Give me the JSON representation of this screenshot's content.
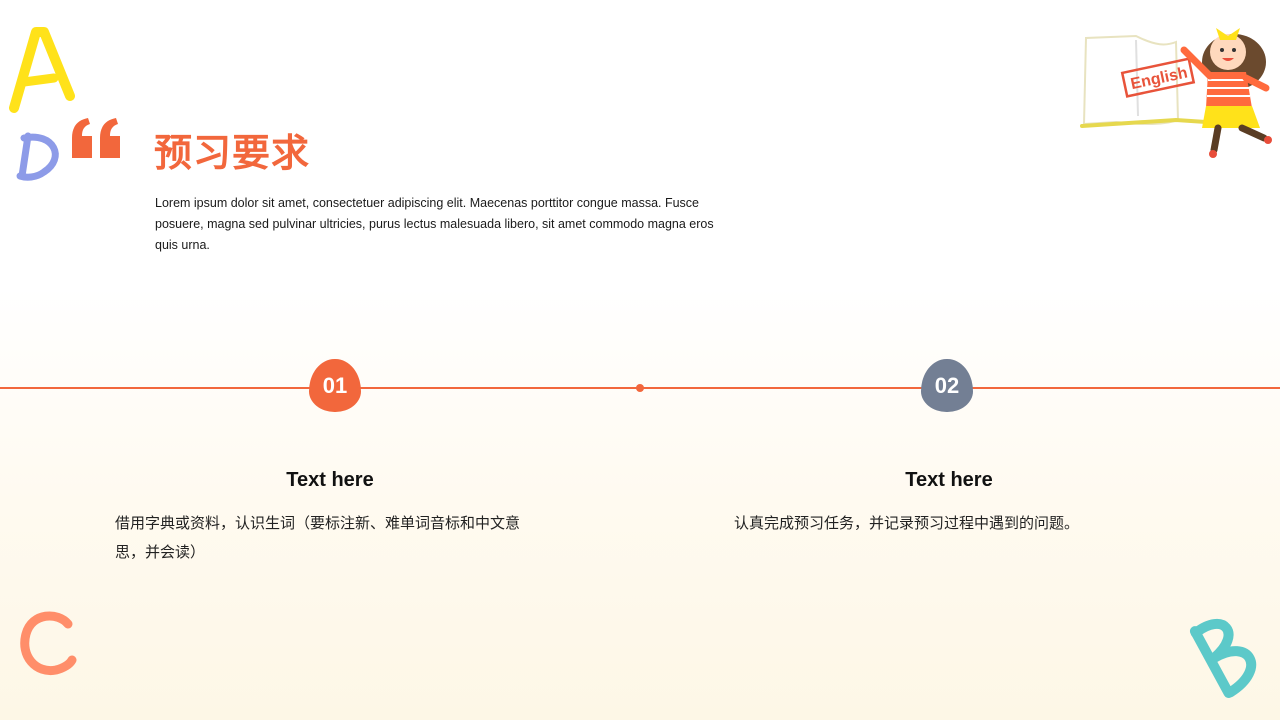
{
  "header": {
    "title": "预习要求",
    "description": "Lorem ipsum dolor sit amet, consectetuer adipiscing elit. Maecenas porttitor congue massa. Fusce posuere, magna sed pulvinar ultricies, purus lectus malesuada libero, sit amet commodo magna eros quis urna."
  },
  "decorations": {
    "letters": [
      "A",
      "D",
      "C",
      "B"
    ],
    "illustration_label": "English",
    "icons": [
      "quote-icon",
      "girl-with-book-illustration"
    ]
  },
  "timeline": {
    "items": [
      {
        "number": "01",
        "title": "Text here",
        "text": "借用字典或资料，认识生词（要标注新、难单词音标和中文意思，并会读）",
        "badge_color": "#f2673c"
      },
      {
        "number": "02",
        "title": "Text here",
        "text": "认真完成预习任务，并记录预习过程中遇到的问题。",
        "badge_color": "#737f94"
      }
    ],
    "line_color": "#f2673c"
  },
  "colors": {
    "accent": "#f2673c",
    "secondary": "#737f94",
    "letter_a": "#ffe21a",
    "letter_d": "#8d9be8",
    "letter_c": "#ff8e6a",
    "letter_b": "#5cc9c9"
  }
}
